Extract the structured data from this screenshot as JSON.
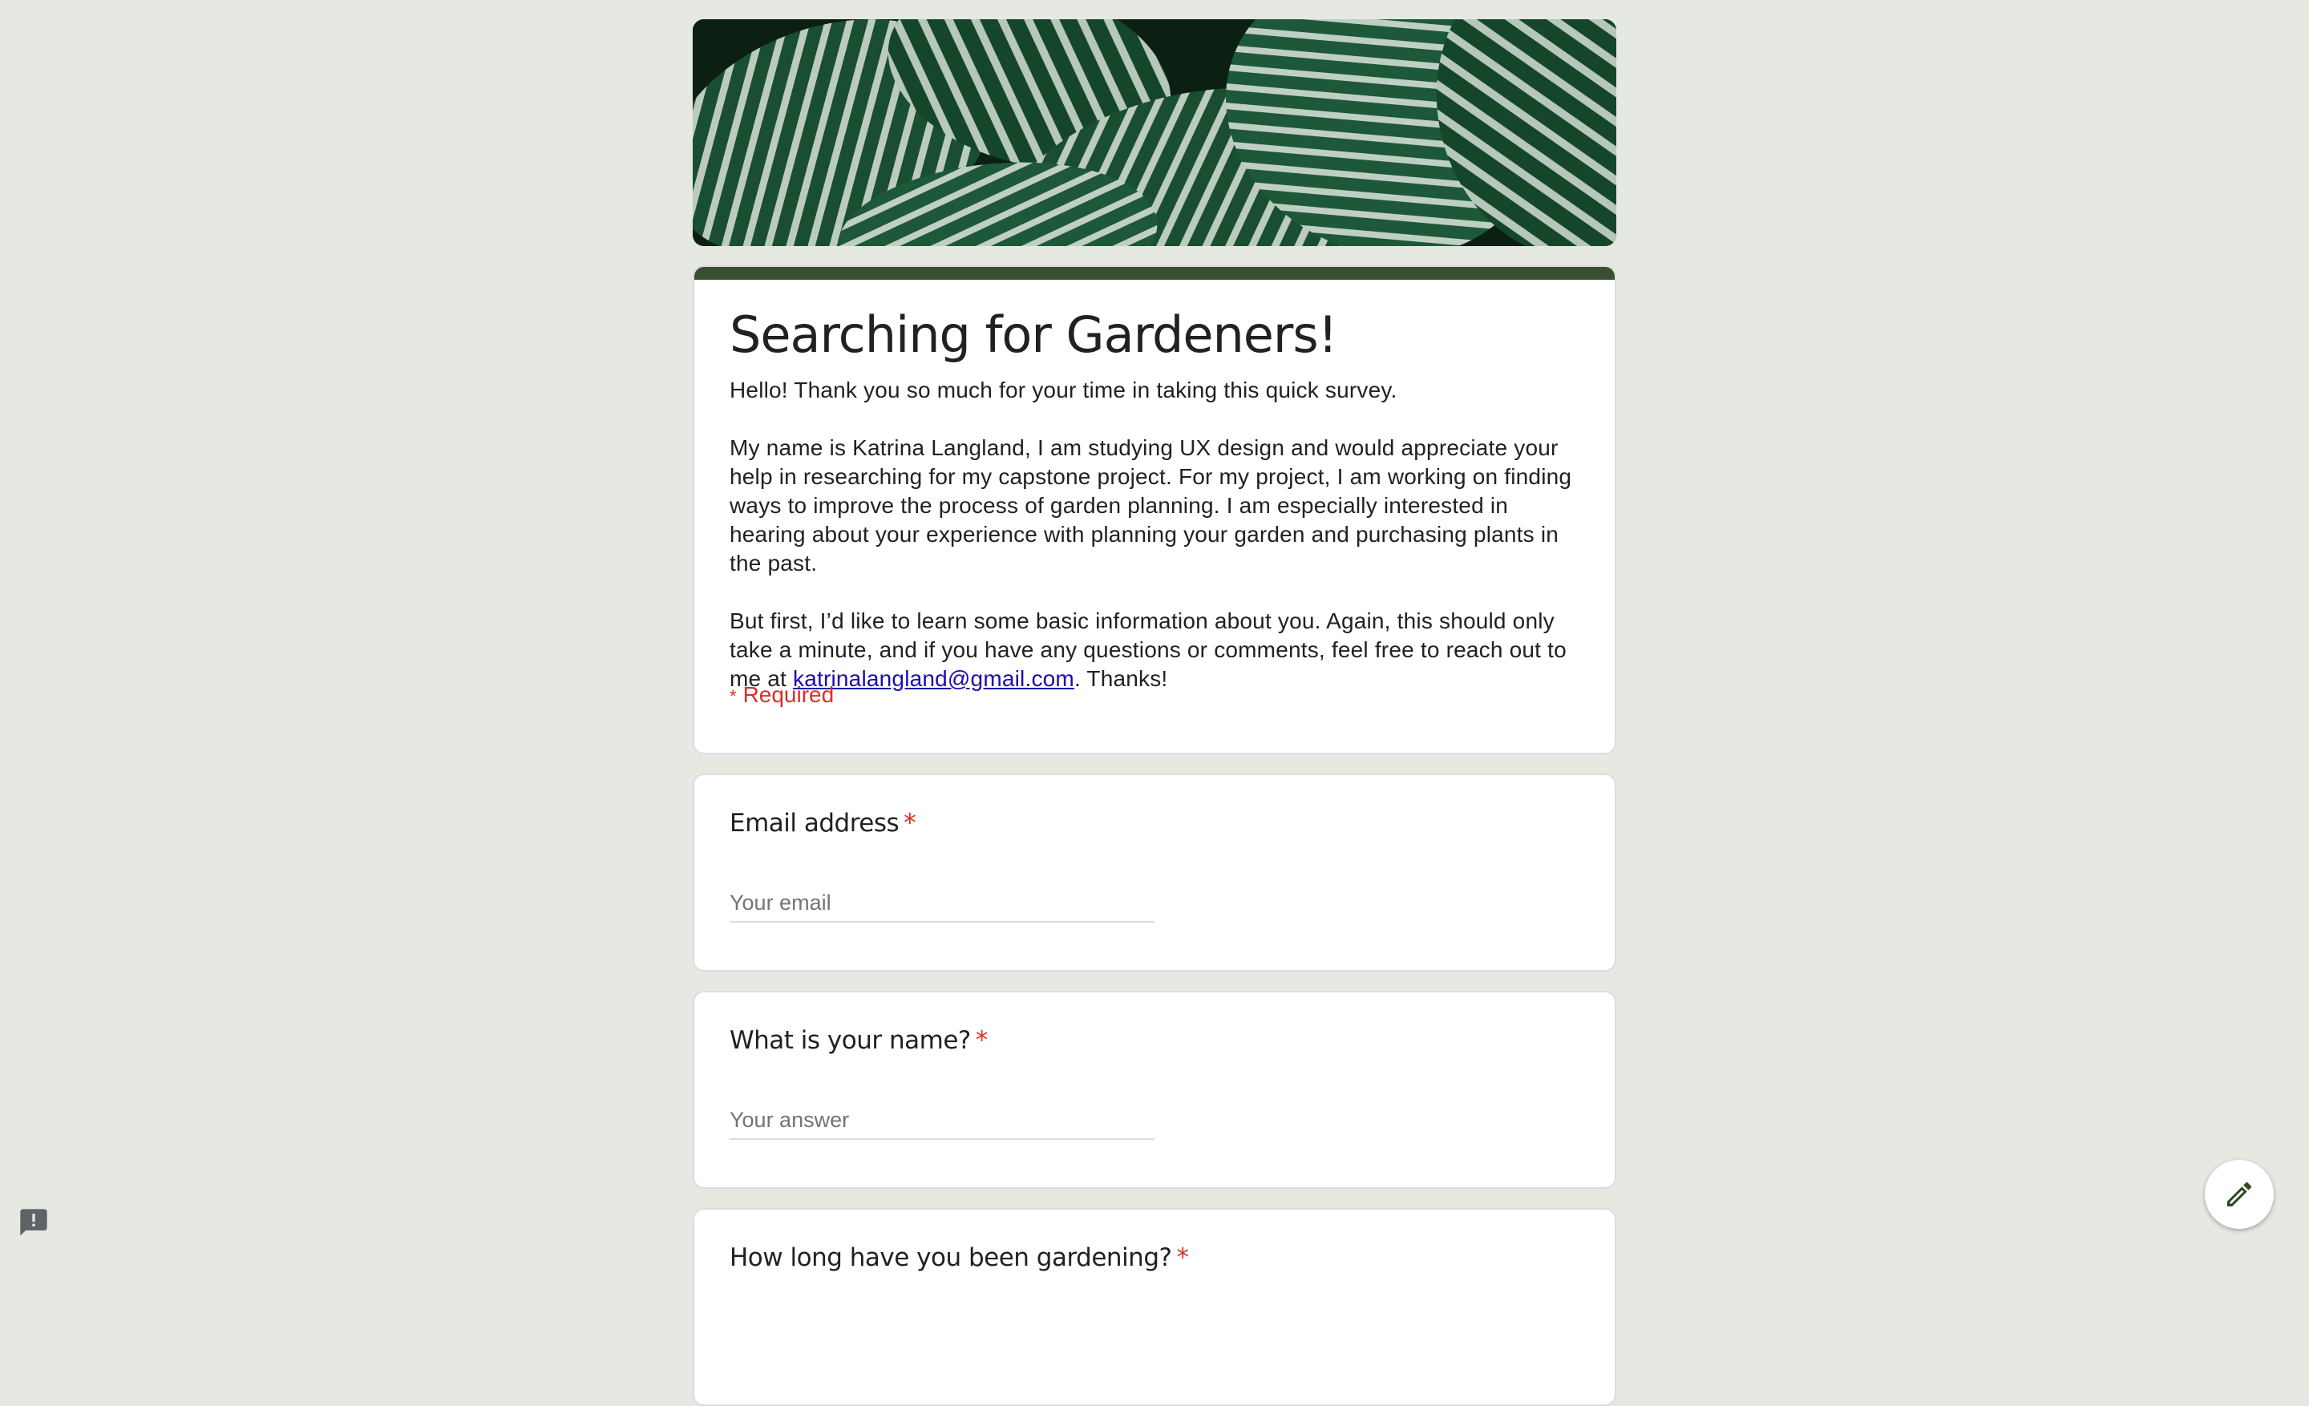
{
  "form": {
    "title": "Searching for Gardeners!",
    "description": {
      "p1": "Hello! Thank you so much for your time in taking this quick survey.",
      "p2": "My name is Katrina Langland, I am studying UX design and would appreciate your help in researching for my capstone project. For my project, I am working on finding ways to improve the process of garden planning. I am especially interested in hearing about your experience with planning your garden and purchasing plants in the past.",
      "p3_before_link": "But first, I’d like to learn some basic information about you. Again, this should only take a minute, and if you have any questions or comments, feel free to reach out to me at ",
      "p3_link": "katrinalangland@gmail.com",
      "p3_after_link": ". Thanks!"
    },
    "required_label": "Required",
    "required_star": "*"
  },
  "questions": [
    {
      "title": "Email address",
      "star": "*",
      "placeholder": "Your email"
    },
    {
      "title": "What is your name?",
      "star": "*",
      "placeholder": "Your answer"
    },
    {
      "title": "How long have you been gardening?",
      "star": "*"
    }
  ],
  "icons": {
    "fab": "edit-pencil-icon",
    "report": "report-feedback-icon"
  },
  "colors": {
    "background": "#e6e8e2",
    "accent": "#3a4f2f",
    "required": "#d93025",
    "link": "#1a0dab"
  }
}
